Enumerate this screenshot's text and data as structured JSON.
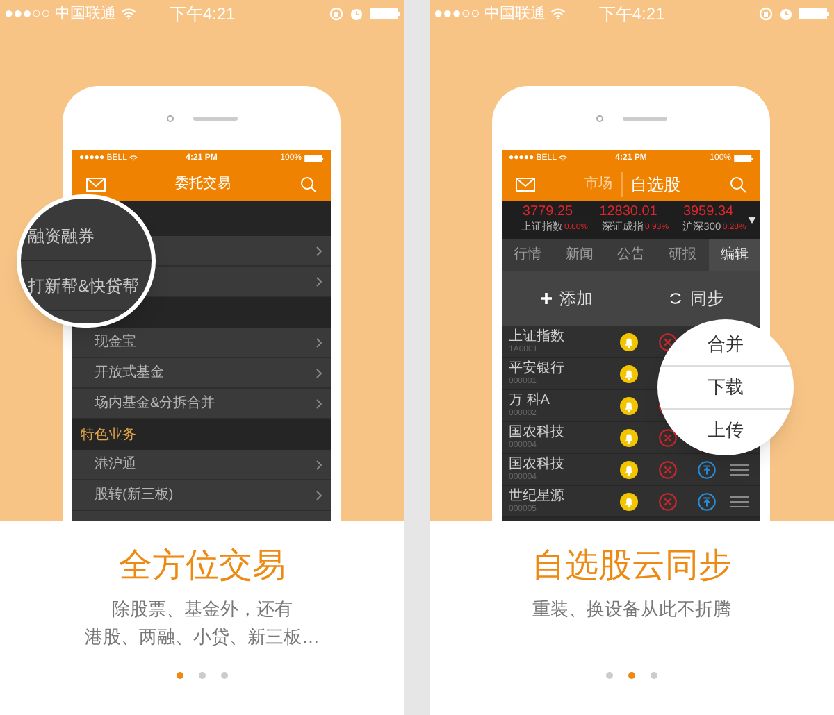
{
  "screens": [
    {
      "status_bar": {
        "carrier": "●●●○○ 中国联通",
        "time": "下午4:21"
      },
      "phone": {
        "kind": "menu",
        "status_bar": {
          "carrier": "●●●●● BELL",
          "time": "4:21 PM",
          "battery": "100%"
        },
        "title": "委托交易",
        "items": [
          {
            "kind": "header"
          },
          {
            "kind": "row"
          },
          {
            "kind": "row"
          },
          {
            "kind": "header"
          },
          {
            "kind": "row",
            "label": "现金宝"
          },
          {
            "kind": "row",
            "label": "开放式基金"
          },
          {
            "kind": "row",
            "label": "场内基金&分拆合并"
          },
          {
            "kind": "header",
            "label": "特色业务"
          },
          {
            "kind": "row",
            "label": "港沪通"
          },
          {
            "kind": "row",
            "label": "股转(新三板)"
          },
          {
            "kind": "row"
          }
        ],
        "magnifier": {
          "items": [
            "融资融券",
            "打新帮&快贷帮"
          ]
        }
      },
      "headline": "全方位交易",
      "lines": [
        "除股票、基金外，还有",
        "港股、两融、小贷、新三板…"
      ],
      "dots": [
        {
          "selected": true
        },
        {
          "selected": false
        },
        {
          "selected": false
        }
      ]
    },
    {
      "status_bar": {
        "carrier": "●●●○○ 中国联通",
        "time": "下午4:21"
      },
      "phone": {
        "kind": "watchlist",
        "status_bar": {
          "carrier": "●●●●● BELL",
          "time": "4:21 PM",
          "battery": "100%"
        },
        "header_tabs": [
          {
            "label": "市场",
            "selected": false
          },
          {
            "label": "自选股",
            "selected": true
          }
        ],
        "indices": [
          {
            "value": "3779.25",
            "name": "上证指数",
            "change": "0.60%"
          },
          {
            "value": "12830.01",
            "name": "深证成指",
            "change": "0.93%"
          },
          {
            "value": "3959.34",
            "name": "沪深300",
            "change": "0.28%"
          }
        ],
        "tabs": [
          {
            "label": "行情",
            "selected": false
          },
          {
            "label": "新闻",
            "selected": false
          },
          {
            "label": "公告",
            "selected": false
          },
          {
            "label": "研报",
            "selected": false
          },
          {
            "label": "编辑",
            "selected": true
          }
        ],
        "actions": [
          {
            "kind": "add",
            "label": "添加"
          },
          {
            "kind": "sync",
            "label": "同步"
          }
        ],
        "stocks": [
          {
            "name": "上证指数",
            "code": "1A0001",
            "remove": true,
            "pin": false,
            "drag": false
          },
          {
            "name": "平安银行",
            "code": "000001",
            "remove": false,
            "pin": false,
            "drag": false
          },
          {
            "name": "万 科A",
            "code": "000002",
            "remove": true,
            "pin": false,
            "drag": false
          },
          {
            "name": "国农科技",
            "code": "000004",
            "remove": true,
            "pin": false,
            "drag": false
          },
          {
            "name": "国农科技",
            "code": "000004",
            "remove": true,
            "pin": true,
            "drag": true
          },
          {
            "name": "世纪星源",
            "code": "000005",
            "remove": true,
            "pin": true,
            "drag": true
          }
        ],
        "magnifier": {
          "items": [
            "合并",
            "下载",
            "上传"
          ]
        }
      },
      "headline": "自选股云同步",
      "lines": [
        "重装、换设备从此不折腾"
      ],
      "dots": [
        {
          "selected": false
        },
        {
          "selected": true
        },
        {
          "selected": false
        }
      ]
    }
  ]
}
